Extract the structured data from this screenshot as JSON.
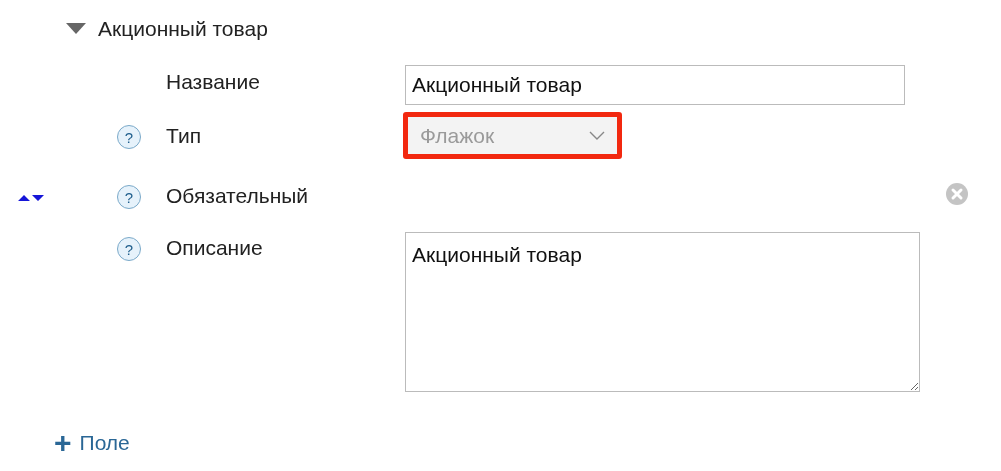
{
  "group": {
    "title": "Акционный товар",
    "expanded": true
  },
  "fields": [
    {
      "kind": "text",
      "label": "Название",
      "value": "Акционный товар"
    },
    {
      "kind": "select",
      "label": "Тип",
      "help": "?",
      "value": "Флажок",
      "disabled": true,
      "highlighted": true
    },
    {
      "kind": "flag",
      "label": "Обязательный",
      "help": "?"
    },
    {
      "kind": "textarea",
      "label": "Описание",
      "help": "?",
      "value": "Акционный товар"
    }
  ],
  "add_button": {
    "icon": "+",
    "label": "Поле"
  }
}
